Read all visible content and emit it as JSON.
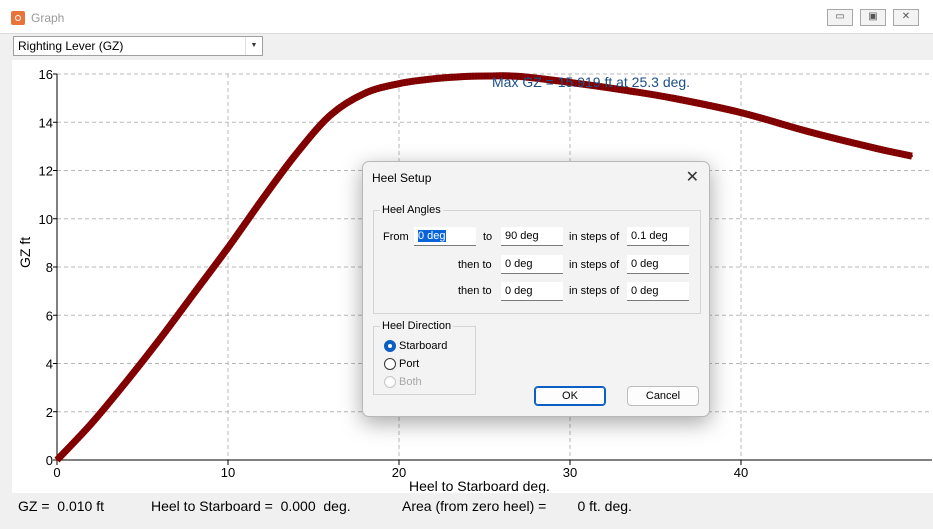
{
  "window": {
    "title": "Graph",
    "minimize_glyph": "▭",
    "restore_glyph": "▣",
    "close_glyph": "✕"
  },
  "toolbar": {
    "graph_select_value": "Righting Lever (GZ)"
  },
  "chart_data": {
    "type": "line",
    "title": "",
    "annotation": "Max GZ = 15.919 ft at 25.3 deg.",
    "xlabel": "Heel to Starboard   deg.",
    "ylabel": "GZ  ft",
    "xlim": [
      0,
      50
    ],
    "ylim": [
      0,
      16
    ],
    "x_ticks": [
      "0",
      "10",
      "20",
      "30",
      "40"
    ],
    "y_ticks": [
      "0",
      "2",
      "4",
      "6",
      "8",
      "10",
      "12",
      "14",
      "16"
    ],
    "grid": true,
    "series": [
      {
        "color": "#8b0000",
        "x": [
          0,
          2,
          4,
          6,
          8,
          10,
          12,
          14,
          16,
          18,
          20,
          22,
          24,
          25.3,
          27,
          30,
          33,
          36,
          40,
          44,
          48,
          50
        ],
        "y": [
          0,
          1.5,
          3.2,
          5.0,
          6.9,
          8.8,
          10.8,
          12.7,
          14.3,
          15.2,
          15.6,
          15.8,
          15.9,
          15.919,
          15.9,
          15.65,
          15.35,
          15.0,
          14.4,
          13.6,
          12.9,
          12.6
        ]
      }
    ]
  },
  "status": {
    "gz": "GZ =  0.010 ft",
    "heel": "Heel to Starboard =  0.000  deg.",
    "area": "Area (from zero heel) =        0 ft. deg."
  },
  "dialog": {
    "title": "Heel Setup",
    "close_glyph": "✕",
    "heel_angles": {
      "legend": "Heel Angles",
      "from_label": "From",
      "from_value": "0 deg",
      "to_label": "to",
      "to_value": "90 deg",
      "steps_label": "in steps of",
      "step1_value": "0.1 deg",
      "then_to_label": "then to",
      "then_to_1": "0 deg",
      "step2_value": "0 deg",
      "then_to_2": "0 deg",
      "step3_value": "0 deg"
    },
    "heel_direction": {
      "legend": "Heel Direction",
      "starboard": "Starboard",
      "port": "Port",
      "both": "Both"
    },
    "ok_label": "OK",
    "cancel_label": "Cancel"
  }
}
